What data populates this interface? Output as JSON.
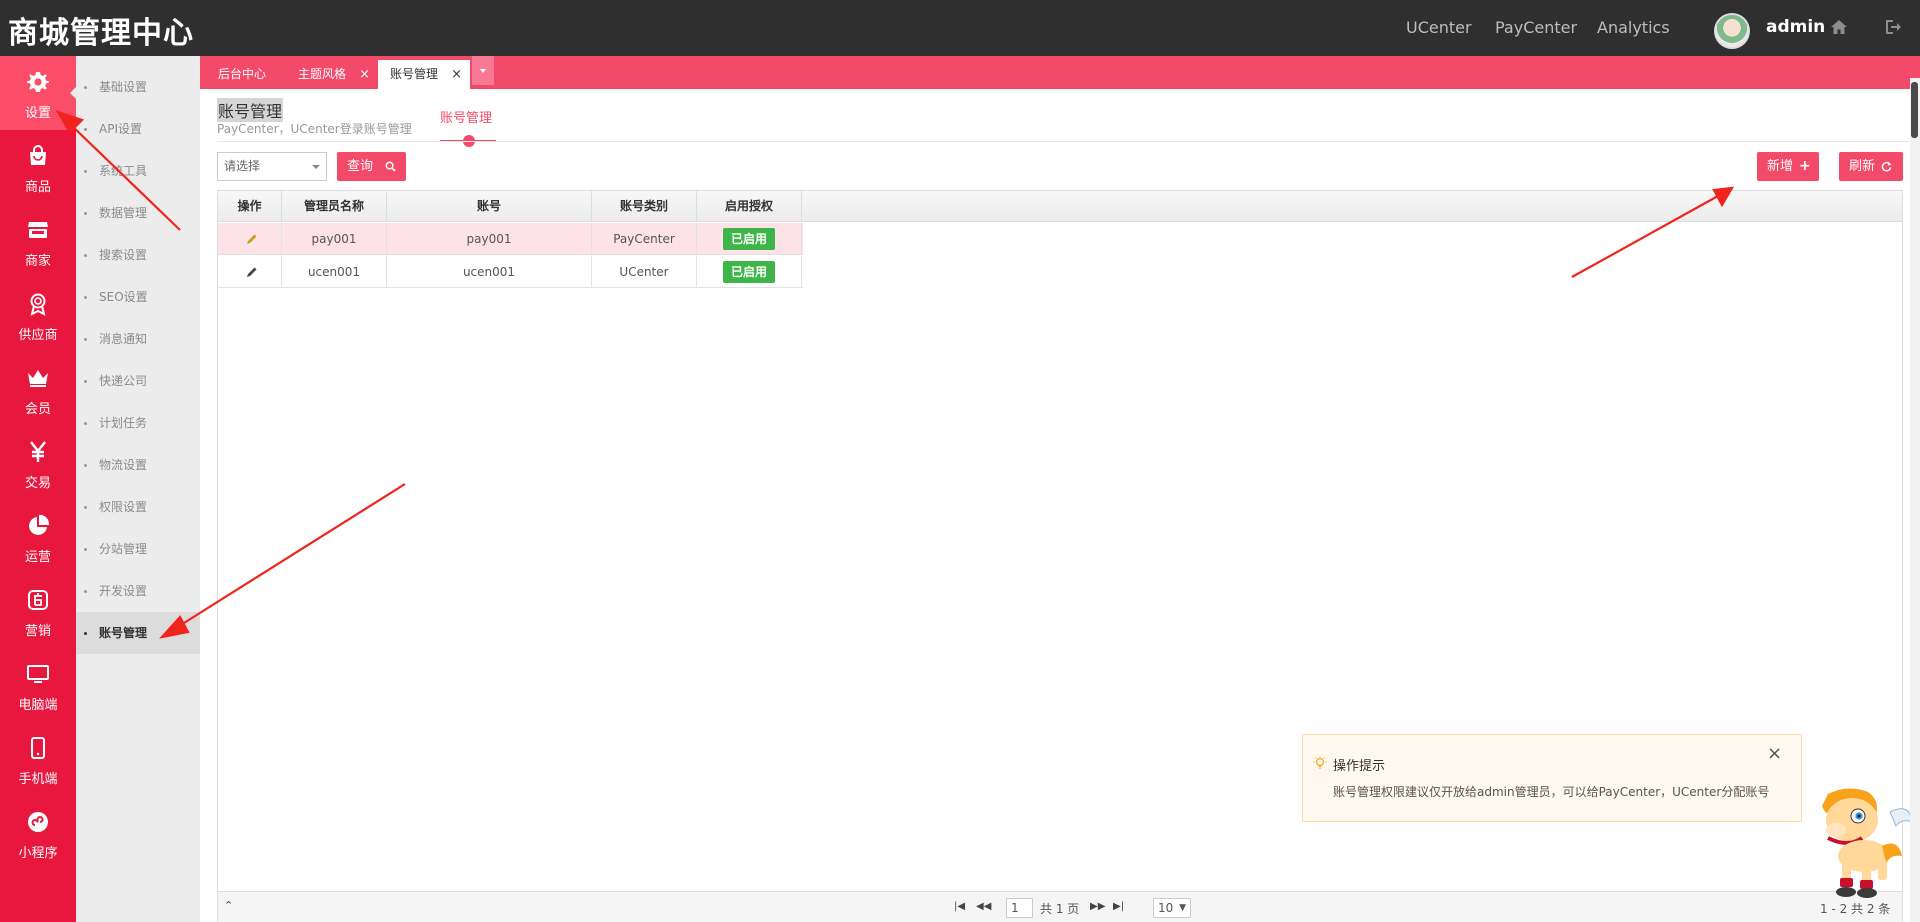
{
  "app": {
    "title": "商城管理中心",
    "user": "admin"
  },
  "topnav": [
    {
      "label": "UCenter"
    },
    {
      "label": "PayCenter"
    },
    {
      "label": "Analytics"
    }
  ],
  "leftnav": [
    {
      "label": "设置",
      "icon": "gear-icon"
    },
    {
      "label": "商品",
      "icon": "bag-icon"
    },
    {
      "label": "商家",
      "icon": "store-icon"
    },
    {
      "label": "供应商",
      "icon": "award-icon"
    },
    {
      "label": "会员",
      "icon": "crown-icon"
    },
    {
      "label": "交易",
      "icon": "yen-icon"
    },
    {
      "label": "运营",
      "icon": "pie-icon"
    },
    {
      "label": "营销",
      "icon": "promo-icon"
    },
    {
      "label": "电脑端",
      "icon": "monitor-icon"
    },
    {
      "label": "手机端",
      "icon": "mobile-icon"
    },
    {
      "label": "小程序",
      "icon": "miniapp-icon"
    }
  ],
  "submenu": [
    {
      "label": "基础设置"
    },
    {
      "label": "API设置"
    },
    {
      "label": "系统工具"
    },
    {
      "label": "数据管理"
    },
    {
      "label": "搜索设置"
    },
    {
      "label": "SEO设置"
    },
    {
      "label": "消息通知"
    },
    {
      "label": "快递公司"
    },
    {
      "label": "计划任务"
    },
    {
      "label": "物流设置"
    },
    {
      "label": "权限设置"
    },
    {
      "label": "分站管理"
    },
    {
      "label": "开发设置"
    },
    {
      "label": "账号管理"
    }
  ],
  "tabs": [
    {
      "label": "后台中心"
    },
    {
      "label": "主题风格",
      "close": "×"
    },
    {
      "label": "账号管理",
      "close": "×"
    }
  ],
  "page": {
    "title": "账号管理",
    "subtitle": "PayCenter，UCenter登录账号管理",
    "subtab": "账号管理"
  },
  "toolbar": {
    "select_value": "请选择",
    "query_label": "查询",
    "add_label": "新增",
    "refresh_label": "刷新"
  },
  "table": {
    "columns": [
      "操作",
      "管理员名称",
      "账号",
      "账号类别",
      "启用授权"
    ],
    "rows": [
      {
        "name": "pay001",
        "account": "pay001",
        "type": "PayCenter",
        "status": "已启用"
      },
      {
        "name": "ucen001",
        "account": "ucen001",
        "type": "UCenter",
        "status": "已启用"
      }
    ]
  },
  "pager": {
    "page": "1",
    "total_pages": "共 1 页",
    "page_size": "10",
    "summary": "1 - 2 共 2 条"
  },
  "tip": {
    "title": "操作提示",
    "body": "账号管理权限建议仅开放给admin管理员，可以给PayCenter，UCenter分配账号",
    "close": "×"
  },
  "colors": {
    "accent": "#f34a6a",
    "sidebar": "#e8173d",
    "topbar": "#2f2f2f",
    "success": "#3eb548"
  }
}
